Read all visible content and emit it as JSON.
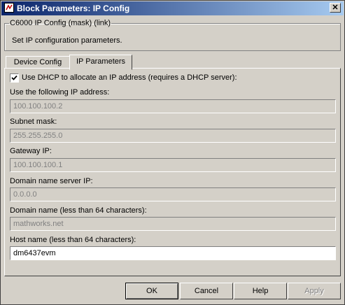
{
  "window": {
    "title": "Block Parameters: IP Config",
    "close_glyph": "✕"
  },
  "block": {
    "group_title": "C6000 IP Config (mask) (link)",
    "description": "Set IP configuration parameters."
  },
  "tabs": [
    {
      "label": "Device Config",
      "active": false
    },
    {
      "label": "IP Parameters",
      "active": true
    }
  ],
  "params": {
    "dhcp_checkbox": {
      "checked": true,
      "label": "Use DHCP to allocate an IP address  (requires a DHCP server):"
    },
    "ip_address": {
      "label": "Use the following IP address:",
      "value": "100.100.100.2",
      "enabled": false
    },
    "subnet_mask": {
      "label": "Subnet mask:",
      "value": "255.255.255.0",
      "enabled": false
    },
    "gateway_ip": {
      "label": "Gateway IP:",
      "value": "100.100.100.1",
      "enabled": false
    },
    "dns_ip": {
      "label": "Domain name server IP:",
      "value": "0.0.0.0",
      "enabled": false
    },
    "domain_name": {
      "label": "Domain name (less than 64 characters):",
      "value": "mathworks.net",
      "enabled": false
    },
    "host_name": {
      "label": "Host name (less than 64 characters):",
      "value": "dm6437evm",
      "enabled": true
    }
  },
  "buttons": {
    "ok": "OK",
    "cancel": "Cancel",
    "help": "Help",
    "apply": "Apply"
  },
  "icons": {
    "app": "simulink-block-icon",
    "close": "close-icon",
    "check": "checkmark-icon"
  }
}
